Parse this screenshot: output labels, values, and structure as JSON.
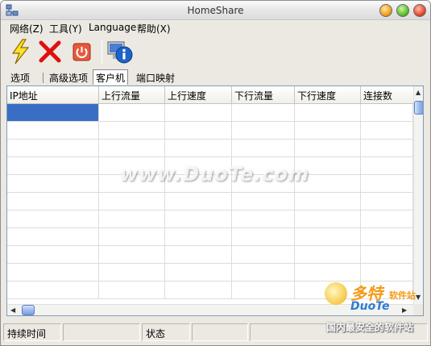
{
  "window": {
    "title": "HomeShare"
  },
  "menu": {
    "items": [
      {
        "label": "网络(Z)"
      },
      {
        "label": "工具(Y)"
      },
      {
        "label": "Language"
      },
      {
        "label": "帮助(X)"
      }
    ]
  },
  "toolbar": {
    "buttons": [
      {
        "icon": "lightning-icon"
      },
      {
        "icon": "close-x-icon"
      },
      {
        "icon": "power-icon"
      },
      {
        "icon": "info-computer-icon"
      }
    ]
  },
  "tabs": [
    {
      "label": "选项"
    },
    {
      "label": "高级选项"
    },
    {
      "label": "客户机",
      "active": true
    },
    {
      "label": "端口映射"
    }
  ],
  "table": {
    "columns": [
      {
        "label": "IP地址"
      },
      {
        "label": "上行流量"
      },
      {
        "label": "上行速度"
      },
      {
        "label": "下行流量"
      },
      {
        "label": "下行速度"
      },
      {
        "label": "连接数"
      }
    ],
    "rows": [
      [],
      [],
      [],
      [],
      [],
      [],
      [],
      [],
      [],
      [],
      []
    ]
  },
  "status": {
    "panes": [
      {
        "label": "持续时间"
      },
      {
        "label": ""
      },
      {
        "label": "状态"
      },
      {
        "label": ""
      },
      {
        "label": ""
      }
    ]
  },
  "watermark": {
    "center": "www.DuoTe.com",
    "brand_cn": "多特",
    "brand_small": "软件站",
    "brand_en": "DuoTe",
    "slogan": "国内最安全的软件站"
  },
  "colors": {
    "selection": "#3a6ec4",
    "grid_border": "#7f9db9",
    "window_bg": "#ece9e2",
    "watermark_orange": "#f39a18",
    "watermark_blue": "#2e7bd6"
  }
}
